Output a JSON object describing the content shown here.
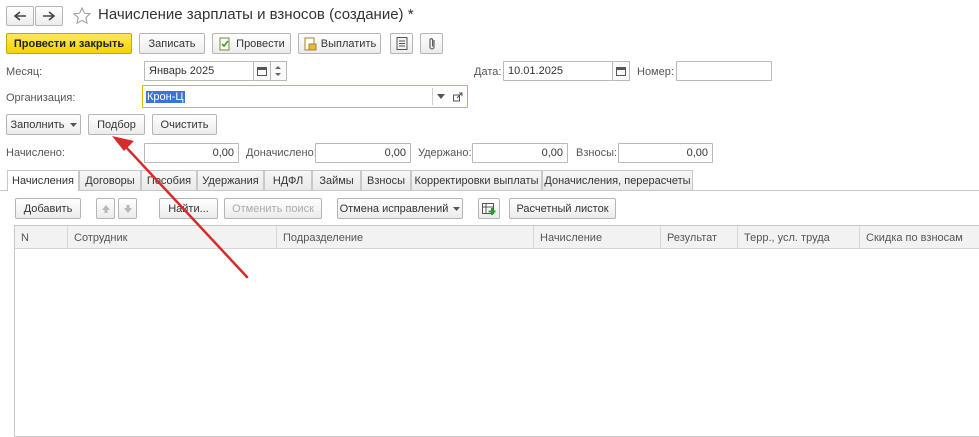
{
  "window": {
    "title": "Начисление зарплаты и взносов (создание) *"
  },
  "toolbar": {
    "post_and_close": "Провести и закрыть",
    "save": "Записать",
    "post": "Провести",
    "pay": "Выплатить"
  },
  "form": {
    "month_label": "Месяц:",
    "month_value": "Январь 2025",
    "date_label": "Дата:",
    "date_value": "10.01.2025",
    "number_label": "Номер:",
    "number_value": "",
    "org_label": "Организация:",
    "org_value": "Крон-Ц"
  },
  "actions": {
    "fill": "Заполнить",
    "select": "Подбор",
    "clear": "Очистить"
  },
  "totals": {
    "accrued_label": "Начислено:",
    "accrued_value": "0,00",
    "additional_label": "Доначислено:",
    "additional_value": "0,00",
    "withheld_label": "Удержано:",
    "withheld_value": "0,00",
    "contributions_label": "Взносы:",
    "contributions_value": "0,00"
  },
  "tabs": [
    "Начисления",
    "Договоры",
    "Пособия",
    "Удержания",
    "НДФЛ",
    "Займы",
    "Взносы",
    "Корректировки выплаты",
    "Доначисления, перерасчеты"
  ],
  "table_toolbar": {
    "add": "Добавить",
    "find": "Найти...",
    "cancel_search": "Отменить поиск",
    "cancel_corrections": "Отмена исправлений",
    "payslip": "Расчетный листок"
  },
  "table": {
    "columns": [
      "N",
      "Сотрудник",
      "Подразделение",
      "Начисление",
      "Результат",
      "Терр., усл. труда",
      "Скидка по взносам"
    ]
  },
  "colors": {
    "primary_button": "#f5d300",
    "annotation_arrow": "#d62b2b",
    "selection": "#3875d7",
    "focus_border": "#e4b800"
  }
}
